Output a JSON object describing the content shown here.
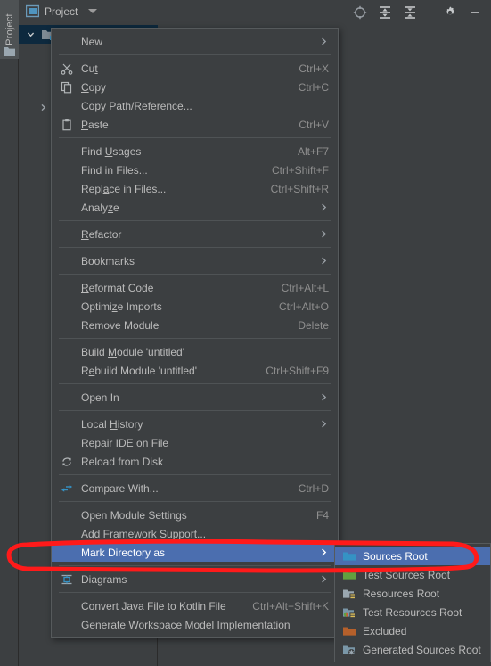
{
  "window": {
    "left_tool_tab": "Project",
    "toolbar": {
      "project_label": "Project",
      "icons": [
        {
          "name": "locate-target-icon",
          "glyph": "target"
        },
        {
          "name": "expand-all-icon",
          "glyph": "expand"
        },
        {
          "name": "collapse-all-icon",
          "glyph": "collapse"
        },
        {
          "name": "settings-gear-icon",
          "glyph": "gear"
        },
        {
          "name": "hide-panel-icon",
          "glyph": "minus"
        }
      ]
    }
  },
  "tree": {
    "rows": [
      {
        "label": "",
        "icon": "folder-module-icon",
        "chevron": "down",
        "selected": true,
        "indent": 8
      },
      {
        "label": "",
        "icon": "",
        "chevron": "right",
        "selected": false,
        "indent": 40
      },
      {
        "label": "",
        "icon": "bars-icon",
        "chevron": "right",
        "selected": false,
        "indent": 22
      },
      {
        "label": "",
        "icon": "folder-clock-icon",
        "chevron": "right",
        "selected": false,
        "indent": 36
      }
    ]
  },
  "context_menu": {
    "groups": [
      {
        "items": [
          {
            "label": "New",
            "icon": "",
            "accel": "",
            "submenu": true,
            "mnemonic": ""
          }
        ]
      },
      {
        "items": [
          {
            "label": "Cut",
            "icon": "scissors-icon",
            "accel": "Ctrl+X",
            "submenu": false,
            "mnemonic": "t"
          },
          {
            "label": "Copy",
            "icon": "copy-icon",
            "accel": "Ctrl+C",
            "submenu": false,
            "mnemonic": "C"
          },
          {
            "label": "Copy Path/Reference...",
            "icon": "",
            "accel": "",
            "submenu": false,
            "mnemonic": ""
          },
          {
            "label": "Paste",
            "icon": "paste-icon",
            "accel": "Ctrl+V",
            "submenu": false,
            "mnemonic": "P"
          }
        ]
      },
      {
        "items": [
          {
            "label": "Find Usages",
            "icon": "",
            "accel": "Alt+F7",
            "submenu": false,
            "mnemonic": "U"
          },
          {
            "label": "Find in Files...",
            "icon": "",
            "accel": "Ctrl+Shift+F",
            "submenu": false,
            "mnemonic": ""
          },
          {
            "label": "Replace in Files...",
            "icon": "",
            "accel": "Ctrl+Shift+R",
            "submenu": false,
            "mnemonic": "a"
          },
          {
            "label": "Analyze",
            "icon": "",
            "accel": "",
            "submenu": true,
            "mnemonic": "z"
          }
        ]
      },
      {
        "items": [
          {
            "label": "Refactor",
            "icon": "",
            "accel": "",
            "submenu": true,
            "mnemonic": "R"
          }
        ]
      },
      {
        "items": [
          {
            "label": "Bookmarks",
            "icon": "",
            "accel": "",
            "submenu": true,
            "mnemonic": ""
          }
        ]
      },
      {
        "items": [
          {
            "label": "Reformat Code",
            "icon": "",
            "accel": "Ctrl+Alt+L",
            "submenu": false,
            "mnemonic": "R"
          },
          {
            "label": "Optimize Imports",
            "icon": "",
            "accel": "Ctrl+Alt+O",
            "submenu": false,
            "mnemonic": "z"
          },
          {
            "label": "Remove Module",
            "icon": "",
            "accel": "Delete",
            "submenu": false,
            "mnemonic": ""
          }
        ]
      },
      {
        "items": [
          {
            "label": "Build Module 'untitled'",
            "icon": "",
            "accel": "",
            "submenu": false,
            "mnemonic": "M"
          },
          {
            "label": "Rebuild Module 'untitled'",
            "icon": "",
            "accel": "Ctrl+Shift+F9",
            "submenu": false,
            "mnemonic": "e"
          }
        ]
      },
      {
        "items": [
          {
            "label": "Open In",
            "icon": "",
            "accel": "",
            "submenu": true,
            "mnemonic": ""
          }
        ]
      },
      {
        "items": [
          {
            "label": "Local History",
            "icon": "",
            "accel": "",
            "submenu": true,
            "mnemonic": "H"
          },
          {
            "label": "Repair IDE on File",
            "icon": "",
            "accel": "",
            "submenu": false,
            "mnemonic": ""
          },
          {
            "label": "Reload from Disk",
            "icon": "reload-icon",
            "accel": "",
            "submenu": false,
            "mnemonic": ""
          }
        ]
      },
      {
        "items": [
          {
            "label": "Compare With...",
            "icon": "compare-icon",
            "accel": "Ctrl+D",
            "submenu": false,
            "mnemonic": ""
          }
        ]
      },
      {
        "items": [
          {
            "label": "Open Module Settings",
            "icon": "",
            "accel": "F4",
            "submenu": false,
            "mnemonic": ""
          },
          {
            "label": "Add Framework Support...",
            "icon": "",
            "accel": "",
            "submenu": false,
            "mnemonic": ""
          },
          {
            "label": "Mark Directory as",
            "icon": "",
            "accel": "",
            "submenu": true,
            "mnemonic": "",
            "selected": true
          }
        ]
      },
      {
        "items": [
          {
            "label": "Diagrams",
            "icon": "diagram-icon",
            "accel": "",
            "submenu": true,
            "mnemonic": ""
          }
        ]
      },
      {
        "items": [
          {
            "label": "Convert Java File to Kotlin File",
            "icon": "",
            "accel": "Ctrl+Alt+Shift+K",
            "submenu": false,
            "mnemonic": ""
          },
          {
            "label": "Generate Workspace Model Implementation",
            "icon": "",
            "accel": "",
            "submenu": false,
            "mnemonic": ""
          }
        ]
      }
    ]
  },
  "submenu": {
    "title": "Mark Directory as",
    "items": [
      {
        "label": "Sources Root",
        "icon": "folder-sources-icon",
        "color": "#3592c4",
        "selected": true
      },
      {
        "label": "Test Sources Root",
        "icon": "folder-test-sources-icon",
        "color": "#62a03f",
        "selected": false
      },
      {
        "label": "Resources Root",
        "icon": "folder-resources-icon",
        "color": "#9aa7b0",
        "selected": false
      },
      {
        "label": "Test Resources Root",
        "icon": "folder-test-resources-icon",
        "color": "#7a97a8",
        "selected": false
      },
      {
        "label": "Excluded",
        "icon": "folder-excluded-icon",
        "color": "#b5602b",
        "selected": false
      },
      {
        "label": "Generated Sources Root",
        "icon": "folder-generated-sources-icon",
        "color": "#7a97a8",
        "selected": false
      }
    ]
  },
  "annotations": {
    "color": "#ff1a1a",
    "shapes": [
      {
        "name": "highlight-oval-mark-directory",
        "desc": "hand drawn red oval around Mark Directory as and Sources Root"
      }
    ]
  },
  "theme": {
    "menu_bg": "#3c3f41",
    "menu_border": "#565a5c",
    "selection_bg": "#4b6eaf",
    "text": "#bbbbbb",
    "accel_text": "#8f8f8f",
    "tree_selection_bg": "#0d293e"
  }
}
